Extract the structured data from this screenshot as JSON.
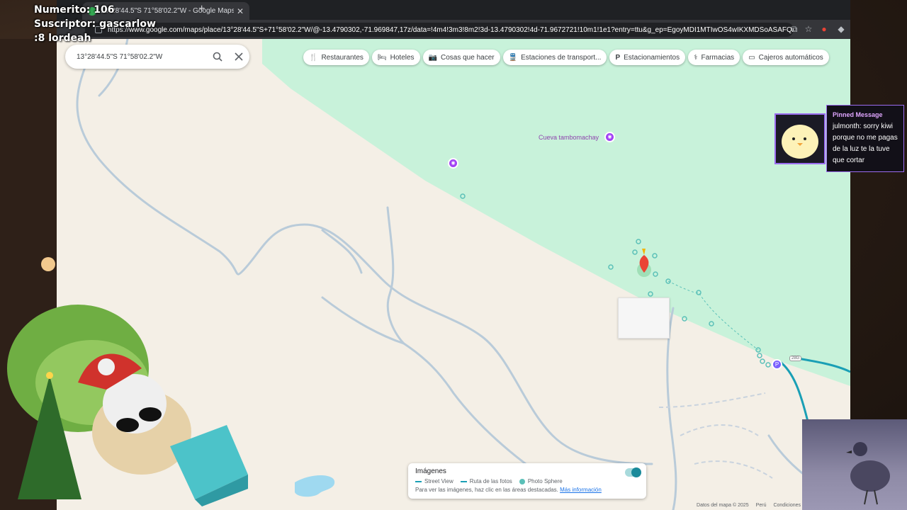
{
  "browser": {
    "tab_title": "13°28'44.5\"S 71°58'02.2\"W - Google Maps",
    "url_prefix": "https://",
    "url": "www.google.com/maps/place/13°28'44.5\"S+71°58'02.2\"W/@-13.4790302,-71.969847,17z/data=!4m4!3m3!8m2!3d-13.4790302!4d-71.9672721!10m1!1e1?entry=ttu&g_ep=EgoyMDI1MTIwOS4wIKXMDSoASAFQAw..."
  },
  "search": {
    "query": "13°28'44.5\"S 71°58'02.2\"W"
  },
  "chips": [
    {
      "icon": "fork-knife-icon",
      "glyph": "🍴",
      "label": "Restaurantes"
    },
    {
      "icon": "bed-icon",
      "glyph": "🛏",
      "label": "Hoteles"
    },
    {
      "icon": "camera-icon",
      "glyph": "📷",
      "label": "Cosas que hacer"
    },
    {
      "icon": "transit-icon",
      "glyph": "🚆",
      "label": "Estaciones de transport..."
    },
    {
      "icon": "parking-icon",
      "glyph": "P",
      "label": "Estacionamientos"
    },
    {
      "icon": "pharmacy-icon",
      "glyph": "⚕",
      "label": "Farmacias"
    },
    {
      "icon": "atm-icon",
      "glyph": "▭",
      "label": "Cajeros automáticos"
    }
  ],
  "map": {
    "poi_label": "Cueva tambomachay",
    "road_badge": "28G",
    "parking_marker": "P",
    "colors": {
      "land": "#f4efe6",
      "park": "#c8f2da",
      "water": "#9fd9f0",
      "creek": "#b7c9d8",
      "streetview": "#1a9fb5",
      "pin": "#ea4335"
    }
  },
  "imagery_panel": {
    "title": "Imágenes",
    "legend": [
      "Street View",
      "Ruta de las fotos",
      "Photo Sphere"
    ],
    "hint": "Para ver las imágenes, haz clic en las áreas destacadas.",
    "more_link": "Más información",
    "toggle_on": true
  },
  "footer": {
    "attribution": "Datos del mapa © 2025",
    "country": "Perú",
    "terms": "Condiciones"
  },
  "stream": {
    "numerito": "Numerito: 106",
    "suscriptor": "Suscriptor: gascarlow",
    "lordeah": ":8  lordeah"
  },
  "pinned": {
    "header": "Pinned Message",
    "body": "julmonth: sorry kiwi porque no me pagas de la luz te la tuve que cortar"
  }
}
